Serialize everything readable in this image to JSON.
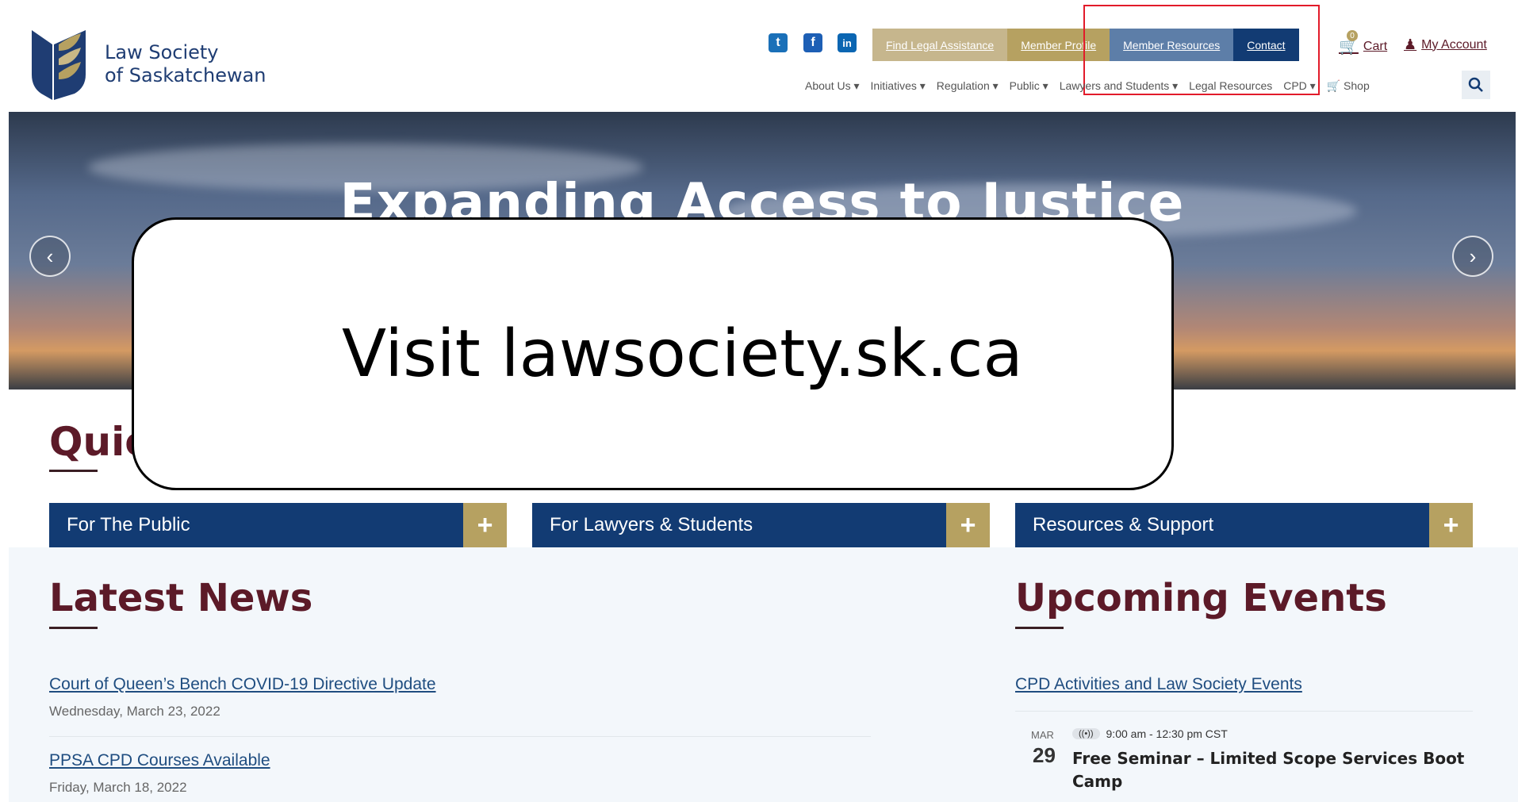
{
  "brand": {
    "line1": "Law Society",
    "line2": "of Saskatchewan"
  },
  "social": [
    {
      "name": "twitter-icon",
      "glyph": "t"
    },
    {
      "name": "facebook-icon",
      "glyph": "f"
    },
    {
      "name": "linkedin-icon",
      "glyph": "in"
    }
  ],
  "top_bar": [
    {
      "label": "Find Legal Assistance",
      "color": "#c6b68d"
    },
    {
      "label": "Member Profile",
      "color": "#b6a161"
    },
    {
      "label": "Member Resources",
      "color": "#5d7ea8"
    },
    {
      "label": "Contact",
      "color": "#123b73"
    }
  ],
  "cart": {
    "label": "Cart",
    "count": "0"
  },
  "account": {
    "label": "My Account"
  },
  "nav": [
    "About Us",
    "Initiatives",
    "Regulation",
    "Public",
    "Lawyers and Students",
    "Legal Resources",
    "CPD",
    "Shop"
  ],
  "hero": {
    "title": "Expanding Access to Justice"
  },
  "overlay": {
    "text": "Visit lawsociety.sk.ca"
  },
  "quick_heading": "Quic",
  "accordions": [
    "For The Public",
    "For Lawyers & Students",
    "Resources & Support"
  ],
  "news": {
    "heading": "Latest News",
    "items": [
      {
        "title": "Court of Queen’s Bench COVID-19 Directive Update",
        "date": "Wednesday, March 23, 2022"
      },
      {
        "title": "PPSA CPD Courses Available",
        "date": "Friday, March 18, 2022"
      }
    ]
  },
  "events": {
    "heading": "Upcoming Events",
    "link": "CPD Activities and Law Society Events",
    "item": {
      "month": "MAR",
      "day": "29",
      "time": "9:00 am - 12:30 pm CST",
      "title": "Free Seminar – Limited Scope Services Boot Camp"
    }
  },
  "colors": {
    "brand_navy": "#123b73",
    "brand_gold": "#b6a161",
    "heading_maroon": "#5c1a28",
    "highlight_red": "#e21b2a"
  }
}
